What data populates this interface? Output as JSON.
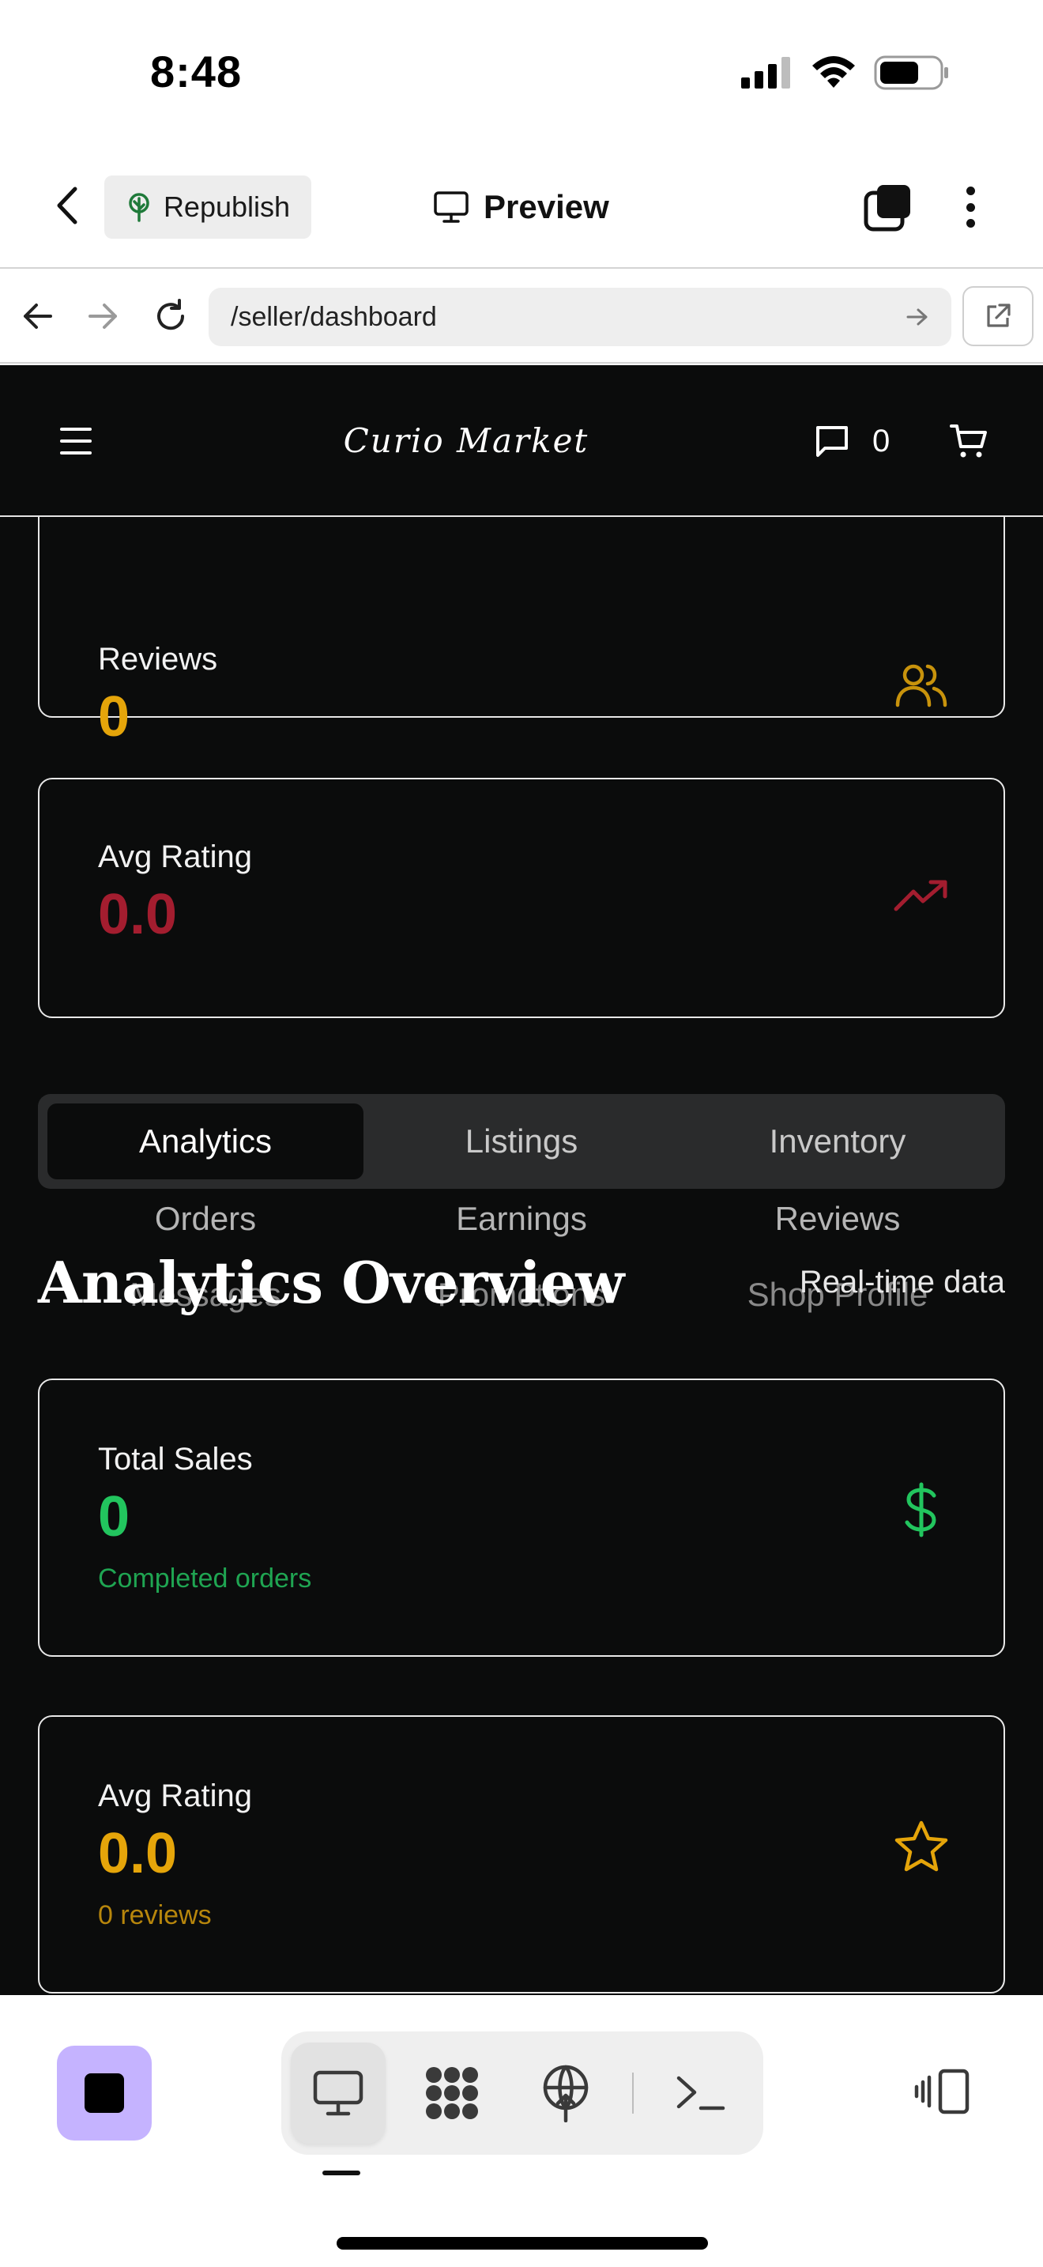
{
  "status_bar": {
    "time": "8:48"
  },
  "editor_bar": {
    "republish_label": "Republish",
    "preview_label": "Preview"
  },
  "url_bar": {
    "url": "/seller/dashboard"
  },
  "site": {
    "brand": "Curio Market",
    "message_count": "0"
  },
  "cards_top": [
    {
      "label": "Reviews",
      "value": "0",
      "color": "#e5a50a",
      "icon": "users-icon"
    },
    {
      "label": "Avg Rating",
      "value": "0.0",
      "color": "#a31d2f",
      "icon": "trending-up-icon"
    }
  ],
  "tabs": {
    "row1": [
      "Analytics",
      "Listings",
      "Inventory"
    ],
    "row2": [
      "Orders",
      "Earnings",
      "Reviews"
    ],
    "row3": [
      "Messages",
      "Promotions",
      "Shop Profile"
    ],
    "active": "Analytics"
  },
  "section": {
    "title": "Analytics Overview",
    "badge": "Real-time data"
  },
  "cards_bottom": [
    {
      "label": "Total Sales",
      "value": "0",
      "sub": "Completed orders",
      "color": "#22c55e",
      "sub_color": "#1fa552",
      "icon": "dollar-icon"
    },
    {
      "label": "Avg Rating",
      "value": "0.0",
      "sub": "0 reviews",
      "color": "#e5a50a",
      "sub_color": "#b7860c",
      "icon": "star-icon"
    }
  ],
  "toolbar": {
    "modes": [
      "desktop-preview",
      "components",
      "deploy",
      "terminal"
    ],
    "accent": "#c5b3ff"
  }
}
